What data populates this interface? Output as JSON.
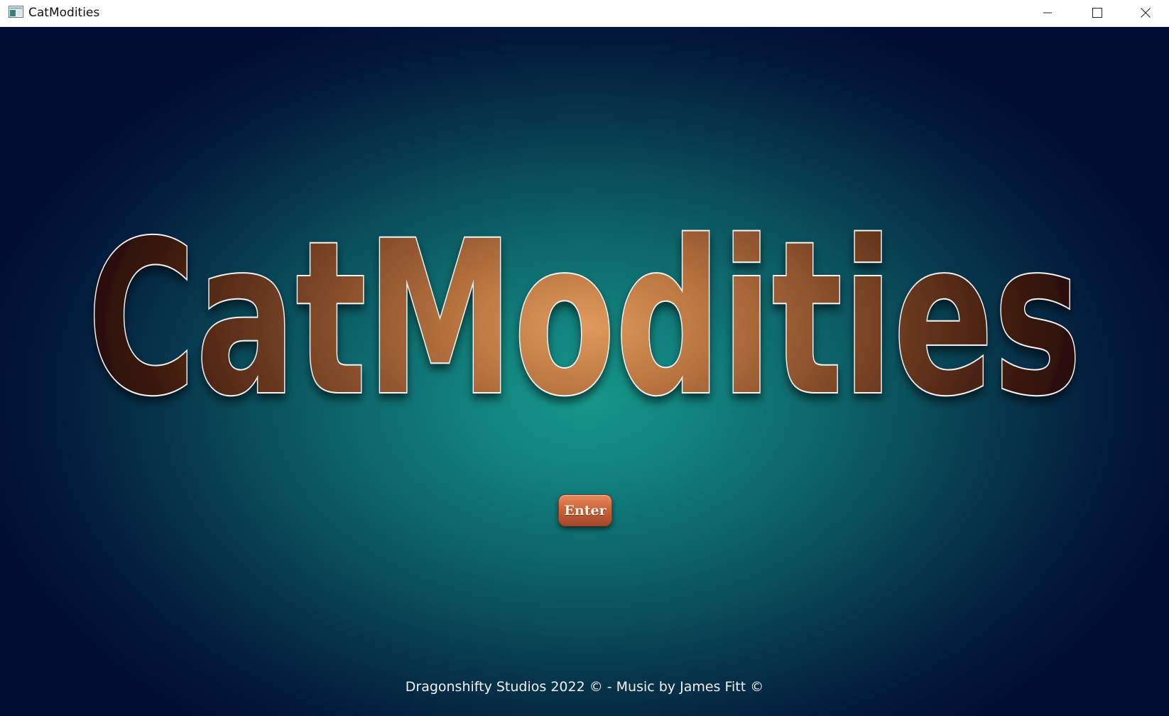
{
  "window": {
    "title": "CatModities",
    "icon": "app-window-icon",
    "controls": {
      "minimize_icon": "minimize-icon",
      "maximize_icon": "maximize-icon",
      "close_icon": "close-icon"
    }
  },
  "game": {
    "logo_text": "CatModities",
    "enter_label": "Enter",
    "credits": "Dragonshifty Studios 2022 © - Music by James Fitt ©"
  },
  "colors": {
    "background_center": "#16988b",
    "background_edge": "#010d33",
    "logo_light": "#d9955a",
    "logo_dark": "#2a1008",
    "logo_outline": "#ffffff",
    "button": "#c8623b"
  }
}
